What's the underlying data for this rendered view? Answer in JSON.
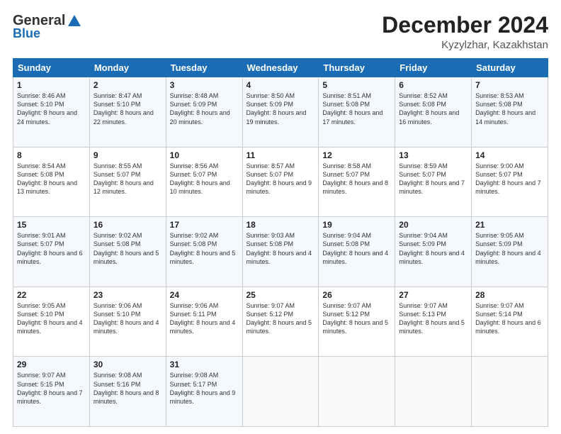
{
  "logo": {
    "general": "General",
    "blue": "Blue"
  },
  "header": {
    "title": "December 2024",
    "subtitle": "Kyzylzhar, Kazakhstan"
  },
  "weekdays": [
    "Sunday",
    "Monday",
    "Tuesday",
    "Wednesday",
    "Thursday",
    "Friday",
    "Saturday"
  ],
  "weeks": [
    [
      {
        "day": "1",
        "sunrise": "8:46 AM",
        "sunset": "5:10 PM",
        "daylight": "8 hours and 24 minutes."
      },
      {
        "day": "2",
        "sunrise": "8:47 AM",
        "sunset": "5:10 PM",
        "daylight": "8 hours and 22 minutes."
      },
      {
        "day": "3",
        "sunrise": "8:48 AM",
        "sunset": "5:09 PM",
        "daylight": "8 hours and 20 minutes."
      },
      {
        "day": "4",
        "sunrise": "8:50 AM",
        "sunset": "5:09 PM",
        "daylight": "8 hours and 19 minutes."
      },
      {
        "day": "5",
        "sunrise": "8:51 AM",
        "sunset": "5:08 PM",
        "daylight": "8 hours and 17 minutes."
      },
      {
        "day": "6",
        "sunrise": "8:52 AM",
        "sunset": "5:08 PM",
        "daylight": "8 hours and 16 minutes."
      },
      {
        "day": "7",
        "sunrise": "8:53 AM",
        "sunset": "5:08 PM",
        "daylight": "8 hours and 14 minutes."
      }
    ],
    [
      {
        "day": "8",
        "sunrise": "8:54 AM",
        "sunset": "5:08 PM",
        "daylight": "8 hours and 13 minutes."
      },
      {
        "day": "9",
        "sunrise": "8:55 AM",
        "sunset": "5:07 PM",
        "daylight": "8 hours and 12 minutes."
      },
      {
        "day": "10",
        "sunrise": "8:56 AM",
        "sunset": "5:07 PM",
        "daylight": "8 hours and 10 minutes."
      },
      {
        "day": "11",
        "sunrise": "8:57 AM",
        "sunset": "5:07 PM",
        "daylight": "8 hours and 9 minutes."
      },
      {
        "day": "12",
        "sunrise": "8:58 AM",
        "sunset": "5:07 PM",
        "daylight": "8 hours and 8 minutes."
      },
      {
        "day": "13",
        "sunrise": "8:59 AM",
        "sunset": "5:07 PM",
        "daylight": "8 hours and 7 minutes."
      },
      {
        "day": "14",
        "sunrise": "9:00 AM",
        "sunset": "5:07 PM",
        "daylight": "8 hours and 7 minutes."
      }
    ],
    [
      {
        "day": "15",
        "sunrise": "9:01 AM",
        "sunset": "5:07 PM",
        "daylight": "8 hours and 6 minutes."
      },
      {
        "day": "16",
        "sunrise": "9:02 AM",
        "sunset": "5:08 PM",
        "daylight": "8 hours and 5 minutes."
      },
      {
        "day": "17",
        "sunrise": "9:02 AM",
        "sunset": "5:08 PM",
        "daylight": "8 hours and 5 minutes."
      },
      {
        "day": "18",
        "sunrise": "9:03 AM",
        "sunset": "5:08 PM",
        "daylight": "8 hours and 4 minutes."
      },
      {
        "day": "19",
        "sunrise": "9:04 AM",
        "sunset": "5:08 PM",
        "daylight": "8 hours and 4 minutes."
      },
      {
        "day": "20",
        "sunrise": "9:04 AM",
        "sunset": "5:09 PM",
        "daylight": "8 hours and 4 minutes."
      },
      {
        "day": "21",
        "sunrise": "9:05 AM",
        "sunset": "5:09 PM",
        "daylight": "8 hours and 4 minutes."
      }
    ],
    [
      {
        "day": "22",
        "sunrise": "9:05 AM",
        "sunset": "5:10 PM",
        "daylight": "8 hours and 4 minutes."
      },
      {
        "day": "23",
        "sunrise": "9:06 AM",
        "sunset": "5:10 PM",
        "daylight": "8 hours and 4 minutes."
      },
      {
        "day": "24",
        "sunrise": "9:06 AM",
        "sunset": "5:11 PM",
        "daylight": "8 hours and 4 minutes."
      },
      {
        "day": "25",
        "sunrise": "9:07 AM",
        "sunset": "5:12 PM",
        "daylight": "8 hours and 5 minutes."
      },
      {
        "day": "26",
        "sunrise": "9:07 AM",
        "sunset": "5:12 PM",
        "daylight": "8 hours and 5 minutes."
      },
      {
        "day": "27",
        "sunrise": "9:07 AM",
        "sunset": "5:13 PM",
        "daylight": "8 hours and 5 minutes."
      },
      {
        "day": "28",
        "sunrise": "9:07 AM",
        "sunset": "5:14 PM",
        "daylight": "8 hours and 6 minutes."
      }
    ],
    [
      {
        "day": "29",
        "sunrise": "9:07 AM",
        "sunset": "5:15 PM",
        "daylight": "8 hours and 7 minutes."
      },
      {
        "day": "30",
        "sunrise": "9:08 AM",
        "sunset": "5:16 PM",
        "daylight": "8 hours and 8 minutes."
      },
      {
        "day": "31",
        "sunrise": "9:08 AM",
        "sunset": "5:17 PM",
        "daylight": "8 hours and 9 minutes."
      },
      null,
      null,
      null,
      null
    ]
  ],
  "labels": {
    "sunrise": "Sunrise: ",
    "sunset": "Sunset: ",
    "daylight": "Daylight: "
  }
}
